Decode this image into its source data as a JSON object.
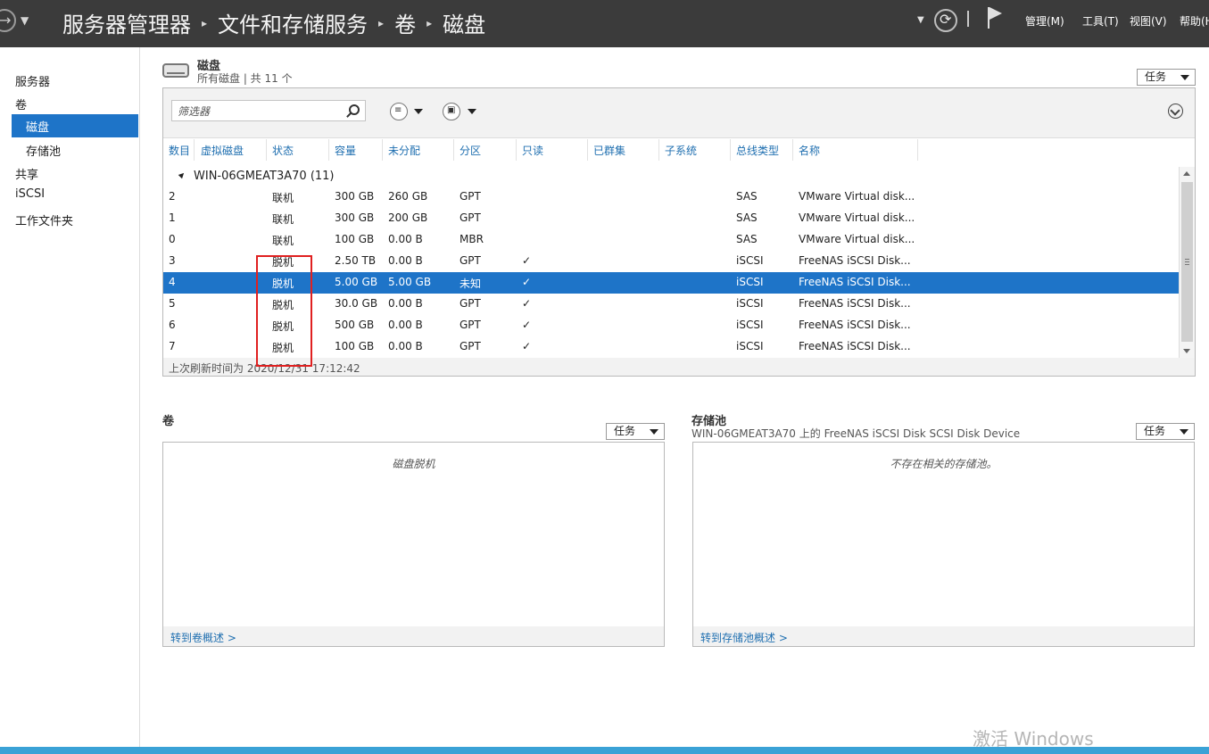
{
  "titlebar": {
    "breadcrumbs": [
      "服务器管理器",
      "文件和存储服务",
      "卷",
      "磁盘"
    ],
    "menus": [
      "管理(M)",
      "工具(T)",
      "视图(V)",
      "帮助(H)"
    ]
  },
  "nav": {
    "items": [
      {
        "label": "服务器",
        "selected": false
      },
      {
        "label": "卷",
        "selected": false
      },
      {
        "label": "磁盘",
        "selected": true
      },
      {
        "label": "存储池",
        "selected": false
      },
      {
        "label": "共享",
        "selected": false
      },
      {
        "label": "iSCSI",
        "selected": false
      },
      {
        "label": "工作文件夹",
        "selected": false
      }
    ]
  },
  "disks": {
    "title": "磁盘",
    "subtitle": "所有磁盘 | 共 11 个",
    "tasks_label": "任务",
    "filter_placeholder": "筛选器",
    "columns": [
      "数目",
      "虚拟磁盘",
      "状态",
      "容量",
      "未分配",
      "分区",
      "只读",
      "已群集",
      "子系统",
      "总线类型",
      "名称"
    ],
    "group_label": "WIN-06GMEAT3A70 (11)",
    "rows": [
      {
        "number": "2",
        "status": "联机",
        "capacity": "300 GB",
        "unallocated": "260 GB",
        "partition": "GPT",
        "readonly": "",
        "bus": "SAS",
        "name": "VMware Virtual disk...",
        "selected": false
      },
      {
        "number": "1",
        "status": "联机",
        "capacity": "300 GB",
        "unallocated": "200 GB",
        "partition": "GPT",
        "readonly": "",
        "bus": "SAS",
        "name": "VMware Virtual disk...",
        "selected": false
      },
      {
        "number": "0",
        "status": "联机",
        "capacity": "100 GB",
        "unallocated": "0.00 B",
        "partition": "MBR",
        "readonly": "",
        "bus": "SAS",
        "name": "VMware Virtual disk...",
        "selected": false
      },
      {
        "number": "3",
        "status": "脱机",
        "capacity": "2.50 TB",
        "unallocated": "0.00 B",
        "partition": "GPT",
        "readonly": "✓",
        "bus": "iSCSI",
        "name": "FreeNAS iSCSI Disk...",
        "selected": false
      },
      {
        "number": "4",
        "status": "脱机",
        "capacity": "5.00 GB",
        "unallocated": "5.00 GB",
        "partition": "未知",
        "readonly": "✓",
        "bus": "iSCSI",
        "name": "FreeNAS iSCSI Disk...",
        "selected": true
      },
      {
        "number": "5",
        "status": "脱机",
        "capacity": "30.0 GB",
        "unallocated": "0.00 B",
        "partition": "GPT",
        "readonly": "✓",
        "bus": "iSCSI",
        "name": "FreeNAS iSCSI Disk...",
        "selected": false
      },
      {
        "number": "6",
        "status": "脱机",
        "capacity": "500 GB",
        "unallocated": "0.00 B",
        "partition": "GPT",
        "readonly": "✓",
        "bus": "iSCSI",
        "name": "FreeNAS iSCSI Disk...",
        "selected": false
      },
      {
        "number": "7",
        "status": "脱机",
        "capacity": "100 GB",
        "unallocated": "0.00 B",
        "partition": "GPT",
        "readonly": "✓",
        "bus": "iSCSI",
        "name": "FreeNAS iSCSI Disk...",
        "selected": false
      }
    ],
    "last_refresh": "上次刷新时间为 2020/12/31 17:12:42"
  },
  "volumes": {
    "title": "卷",
    "tasks_label": "任务",
    "message": "磁盘脱机",
    "link": "转到卷概述 >"
  },
  "pools": {
    "title": "存储池",
    "subtitle": "WIN-06GMEAT3A70 上的 FreeNAS iSCSI Disk SCSI Disk Device",
    "tasks_label": "任务",
    "message": "不存在相关的存储池。",
    "link": "转到存储池概述 >"
  },
  "watermark": "激活 Windows",
  "colors": {
    "titlebar": "#3b3b3b",
    "selection": "#1e74c8",
    "highlight_box": "#e02020",
    "header_text": "#1f6fb0"
  }
}
